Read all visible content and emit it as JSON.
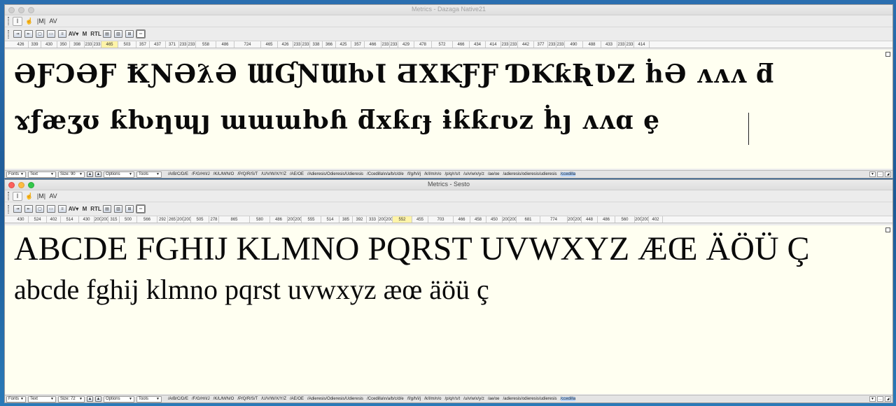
{
  "window1": {
    "title": "Metrics - Dazaga Native21",
    "metrics": [
      "426",
      "339",
      "430",
      "350",
      "398",
      "233",
      "233",
      "465",
      "503",
      "357",
      "437",
      "371",
      "233",
      "233",
      "558",
      "486",
      "724",
      "465",
      "426",
      "233",
      "233",
      "338",
      "366",
      "425",
      "357",
      "466",
      "233",
      "233",
      "429",
      "478",
      "572",
      "466",
      "434",
      "414",
      "233",
      "233",
      "442",
      "377",
      "233",
      "233",
      "490",
      "488",
      "433",
      "233",
      "233",
      "414"
    ],
    "sample_line1": "ƏƑƆƏƑ  ҞƝƏƛƏ  ƜƓƝƜƕƖ  ƋXƘƑƑ  ƊƘƙƦƲZ  ḣƏ  ʌʌʌ  ƌ",
    "sample_line2": "ɤƒæʒʊ  ƙƕƞɰȷ  ɯɯɯƕɦ  ƌxƙɾɟ  ɨƙƙɾʋz  ḣȷ  ʌʌɑ  ȩ",
    "status": {
      "fonts": "Fonts",
      "text": "Text",
      "size": "Size: 90",
      "options": "Options",
      "tools": "Tools"
    }
  },
  "window2": {
    "title": "Metrics - Sesto",
    "metrics": [
      "430",
      "524",
      "402",
      "514",
      "430",
      "200",
      "200",
      "315",
      "500",
      "566",
      "292",
      "265",
      "200",
      "200",
      "505",
      "278",
      "865",
      "580",
      "486",
      "200",
      "200",
      "555",
      "514",
      "385",
      "392",
      "333",
      "200",
      "200",
      "552",
      "455",
      "703",
      "466",
      "458",
      "450",
      "200",
      "200",
      "681",
      "774",
      "200",
      "200",
      "448",
      "486",
      "560",
      "200",
      "200",
      "402"
    ],
    "sample_line1": "ABCDE FGHIJ KLMNO PQRST UVWXYZ ÆŒ ÄÖÜ Ç",
    "sample_line2": "abcde fghij klmno pqrst uvwxyz æœ äöü ç",
    "status": {
      "fonts": "Fonts",
      "text": "Text",
      "size": "Size: 72",
      "options": "Options",
      "tools": "Tools"
    }
  },
  "glyph_strings_1": [
    "/A/B/C/D/E",
    "/F/G/H/I/J",
    "/K/L/M/N/O",
    "/P/Q/R/S/T",
    "/U/V/W/X/Y/Z",
    "/AE/OE",
    "/Adieresis/Odieresis/Udieresis",
    "/Ccedilla\\n/a/b/c/d/e",
    "/f/g/h/i/j",
    "/k/l/m/n/o",
    "/p/q/r/s/t",
    "/u/v/w/x/y/z",
    "/ae/oe",
    "/adieresis/odieresis/udieresis"
  ],
  "glyph_strings_2": [
    "/A/B/C/D/E",
    "/F/G/H/I/J",
    "/K/L/M/N/O",
    "/P/Q/R/S/T",
    "/U/V/W/X/Y/Z",
    "/AE/OE",
    "/Adieresis/Odieresis/Udieresis",
    "/Ccedilla\\n/a/b/c/d/e",
    "/f/g/h/i/j",
    "/k/l/m/n/o",
    "/p/q/r/s/t",
    "/u/v/w/x/y/z",
    "/ae/oe",
    "/adieresis/odieresis/udieresis"
  ],
  "glyph_selected": "/ccedilla",
  "tools": {
    "row1": [
      "text-tool-icon",
      "hand-tool-icon",
      "measure-tool-icon",
      "kern-tool-icon"
    ],
    "row1_labels": [
      "I",
      "☝",
      "|M|",
      "AV"
    ]
  }
}
